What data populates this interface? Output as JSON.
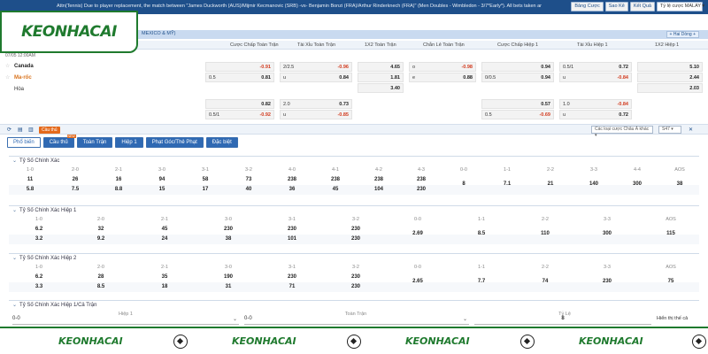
{
  "topbar": {
    "ticker": "Attn(Tennis) Due to player replacement, the match between \"James Duckworth (AUS)/Mijmir Kecmanovic (SRB) -vs- Benjamin Bonzi (FRA)/Arthur Rinderknech (FRA)\" (Men Doubles - Wimbledon - 3/7*Early*). All bets taken are",
    "buttons": [
      "Bảng Cược",
      "Sao Kê",
      "Kết Quả"
    ],
    "odds_type": "Tỷ lệ cược MALAY ▾"
  },
  "logo": "KEONHACAI",
  "match": {
    "league": "MEXICO & MỸ)",
    "header_button": "+ Hai Dòng +",
    "time": "07/05 12:00AM",
    "teams": [
      "Canada",
      "Ma-rốc",
      "Hòa"
    ],
    "columns": [
      "Cược Chấp Toàn Trận",
      "Tài Xỉu Toàn Trận",
      "1X2 Toàn Trận",
      "Chẵn Lẻ Toàn Trận",
      "Cược Chấp Hiệp 1",
      "Tài Xỉu Hiệp 1",
      "1X2 Hiệp 1"
    ],
    "row1": {
      "a": "",
      "a_v": "-0.91",
      "b": "2/2.5",
      "b_v": "-0.96",
      "c": "4.65",
      "d": "o",
      "d_v": "-0.98",
      "e": "",
      "e_v": "0.94",
      "f": "0.5/1",
      "f_v": "0.72",
      "g": "5.10"
    },
    "row2": {
      "a": "0.5",
      "a_v": "0.81",
      "b": "u",
      "b_v": "0.84",
      "c": "1.81",
      "d": "e",
      "d_v": "0.88",
      "e": "0/0.5",
      "e_v": "0.94",
      "f": "u",
      "f_v": "-0.84",
      "g": "2.44"
    },
    "row3": {
      "c": "3.40",
      "g": "2.03"
    },
    "row4": {
      "a_v": "0.82",
      "b": "2.0",
      "b_v": "0.73",
      "e_v": "0.57",
      "f": "1.0",
      "f_v": "-0.84"
    },
    "row5": {
      "a": "0.5/1",
      "a_v": "-0.92",
      "b": "u",
      "b_v": "-0.85",
      "e": "0.5",
      "e_v": "-0.69",
      "f": "u",
      "f_v": "0.72"
    }
  },
  "toolbar": {
    "live": "Cầu thủ",
    "bet_type_select": "Các loại cược Châu Á khác ▾",
    "sort_select": "S47 ▾"
  },
  "tabs": [
    {
      "label": "Phổ biến",
      "active": true
    },
    {
      "label": "Cầu thủ",
      "active": false,
      "badge": "NEW"
    },
    {
      "label": "Toàn Trận",
      "active": false
    },
    {
      "label": "Hiệp 1",
      "active": false
    },
    {
      "label": "Phạt Góc/Thẻ Phạt",
      "active": false
    },
    {
      "label": "Đặc biệt",
      "active": false
    }
  ],
  "sections": [
    {
      "title": "Tỷ Số Chính Xác",
      "left_headers": [
        "1-0",
        "2-0",
        "2-1",
        "3-0",
        "3-1",
        "3-2",
        "4-0",
        "4-1",
        "4-2",
        "4-3"
      ],
      "left_row1": [
        "11",
        "26",
        "16",
        "94",
        "58",
        "73",
        "238",
        "238",
        "238",
        "238"
      ],
      "left_row2": [
        "5.8",
        "7.5",
        "8.8",
        "15",
        "17",
        "40",
        "36",
        "45",
        "104",
        "230"
      ],
      "right_headers": [
        "0-0",
        "1-1",
        "2-2",
        "3-3",
        "4-4",
        "AOS"
      ],
      "right_vals": [
        "8",
        "7.1",
        "21",
        "140",
        "300",
        "38"
      ]
    },
    {
      "title": "Tỷ Số Chính Xác Hiệp 1",
      "left_headers": [
        "1-0",
        "2-0",
        "2-1",
        "3-0",
        "3-1",
        "3-2"
      ],
      "left_row1": [
        "6.2",
        "32",
        "45",
        "230",
        "230",
        "230"
      ],
      "left_row2": [
        "3.2",
        "9.2",
        "24",
        "38",
        "101",
        "230"
      ],
      "right_headers": [
        "0-0",
        "1-1",
        "2-2",
        "3-3",
        "AOS"
      ],
      "right_vals": [
        "2.69",
        "8.5",
        "110",
        "300",
        "115"
      ]
    },
    {
      "title": "Tỷ Số Chính Xác Hiệp 2",
      "left_headers": [
        "1-0",
        "2-0",
        "2-1",
        "3-0",
        "3-1",
        "3-2"
      ],
      "left_row1": [
        "6.2",
        "28",
        "35",
        "190",
        "230",
        "230"
      ],
      "left_row2": [
        "3.3",
        "8.5",
        "18",
        "31",
        "71",
        "230"
      ],
      "right_headers": [
        "0-0",
        "1-1",
        "2-2",
        "3-3",
        "AOS"
      ],
      "right_vals": [
        "2.65",
        "7.7",
        "74",
        "230",
        "75"
      ]
    }
  ],
  "last_section": {
    "title": "Tỷ Số Chính Xác Hiệp 1/Cả Trận",
    "headers": [
      "Hiệp 1",
      "Toàn Trận",
      "Tỷ Lệ"
    ],
    "select1": "0-0",
    "select2": "0-0",
    "odds": "8",
    "hint": "Hiển thị thế cả"
  },
  "colors": {
    "brand_green": "#1f7a2e",
    "topbar": "#1e4f8a",
    "negative": "#d23b1f"
  }
}
